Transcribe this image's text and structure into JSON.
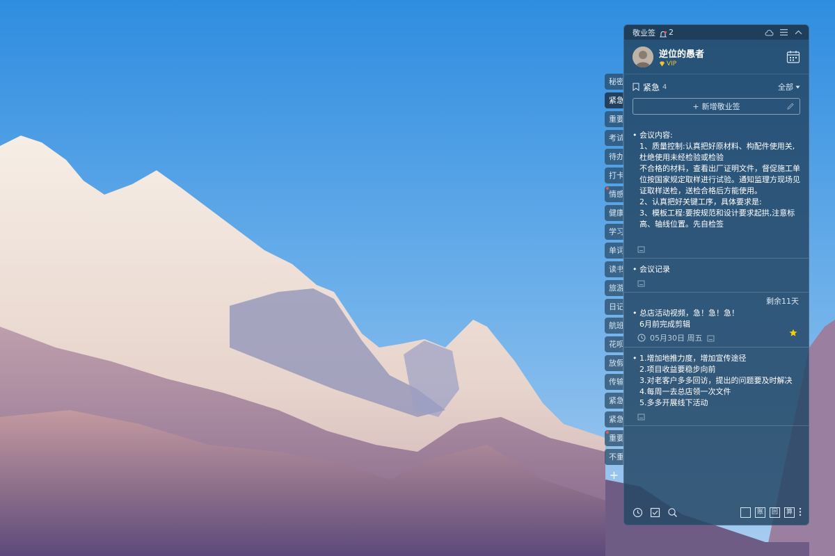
{
  "side_tabs": [
    {
      "label": "秘密",
      "active": false,
      "dot": false
    },
    {
      "label": "紧急",
      "active": true,
      "dot": false
    },
    {
      "label": "重要",
      "active": false,
      "dot": false
    },
    {
      "label": "考试",
      "active": false,
      "dot": false
    },
    {
      "label": "待办",
      "active": false,
      "dot": false
    },
    {
      "label": "打卡",
      "active": false,
      "dot": false
    },
    {
      "label": "情感",
      "active": false,
      "dot": true
    },
    {
      "label": "健康",
      "active": false,
      "dot": false
    },
    {
      "label": "学习",
      "active": false,
      "dot": false
    },
    {
      "label": "单词",
      "active": false,
      "dot": false
    },
    {
      "label": "读书",
      "active": false,
      "dot": false
    },
    {
      "label": "旅游",
      "active": false,
      "dot": false
    },
    {
      "label": "日记",
      "active": false,
      "dot": false
    },
    {
      "label": "航班",
      "active": false,
      "dot": false
    },
    {
      "label": "花呗",
      "active": false,
      "dot": false
    },
    {
      "label": "放假",
      "active": false,
      "dot": false
    },
    {
      "label": "传输",
      "active": false,
      "dot": false
    },
    {
      "label": "紧急",
      "active": false,
      "dot": false
    },
    {
      "label": "紧急",
      "active": false,
      "dot": false
    },
    {
      "label": "重要",
      "active": false,
      "dot": true
    },
    {
      "label": "不重",
      "active": false,
      "dot": false
    }
  ],
  "side_add_label": "+",
  "app": {
    "title": "敬业签",
    "notification_count": "2"
  },
  "user": {
    "name": "逆位的愚者",
    "vip_label": "VIP"
  },
  "category": {
    "name": "紧急",
    "count": "4",
    "filter_label": "全部"
  },
  "add_note": {
    "label": "新增敬业签"
  },
  "notes": [
    {
      "text": "会议内容:\n1、质量控制:认真把好原材料、构配件使用关,杜绝使用未经检验或检验\n不合格的材料，查看出厂证明文件，督促施工单位按国家规定取样进行试验。通知监理方现场见证取样送检，送检合格后方能使用。\n2、认真把好关键工序，具体要求是:\n3、模板工程:要按规范和设计要求起拱,注意标高、轴线位置。先自检签\n"
    },
    {
      "text": "会议记录"
    },
    {
      "remaining": "剩余11天",
      "text": "总店活动视频，急！急！急！\n6月前完成剪辑",
      "date": "05月30日 周五"
    },
    {
      "text": "1.增加地推力度，增加宣传途径\n2.项目收益要稳步向前\n3.对老客户多多回访，提出的问题要及时解决\n4.每周一去总店领一次文件\n5.多多开展线下活动"
    }
  ],
  "footer": {
    "right_labels": [
      "",
      "账",
      "回",
      "算"
    ]
  },
  "colors": {
    "panel": "#24465f",
    "vip": "#f4c430",
    "star": "#f5d000",
    "tab_dot": "#e55a4a"
  }
}
